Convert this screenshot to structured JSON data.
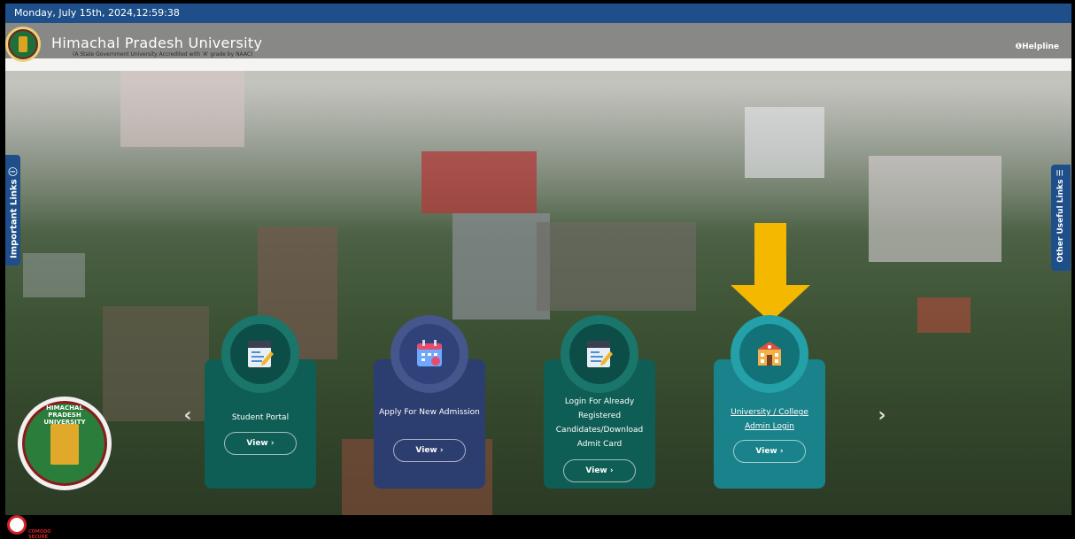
{
  "topbar": {
    "datetime": "Monday, July 15th, 2024,12:59:38"
  },
  "header": {
    "title": "Himachal Pradesh University",
    "subtitle": "(A State Government University Accredited with 'A' grade by NAAC)",
    "helpline": "❶Helpline"
  },
  "side_tabs": {
    "left": "Important Links ⓘ",
    "right": "Other Useful Links ☰"
  },
  "cards": [
    {
      "label": "Student Portal",
      "button": "View ›"
    },
    {
      "label": "Apply For New Admission",
      "button": "View ›"
    },
    {
      "label": "Login For Already Registered Candidates/Download Admit Card",
      "button": "View ›"
    },
    {
      "label": "University / College Admin Login",
      "button": "View ›"
    }
  ],
  "carousel": {
    "prev": "‹",
    "next": "›"
  },
  "emblem": {
    "text": "HIMACHAL PRADESH UNIVERSITY"
  },
  "footer": {
    "security_badge": "COMODO SECURE"
  },
  "colors": {
    "topbar": "#1e4f8a",
    "card_green": "#0f5e55",
    "card_navy": "#2c3d6f",
    "card_teal": "#19828a",
    "highlight_arrow": "#f5b800"
  }
}
